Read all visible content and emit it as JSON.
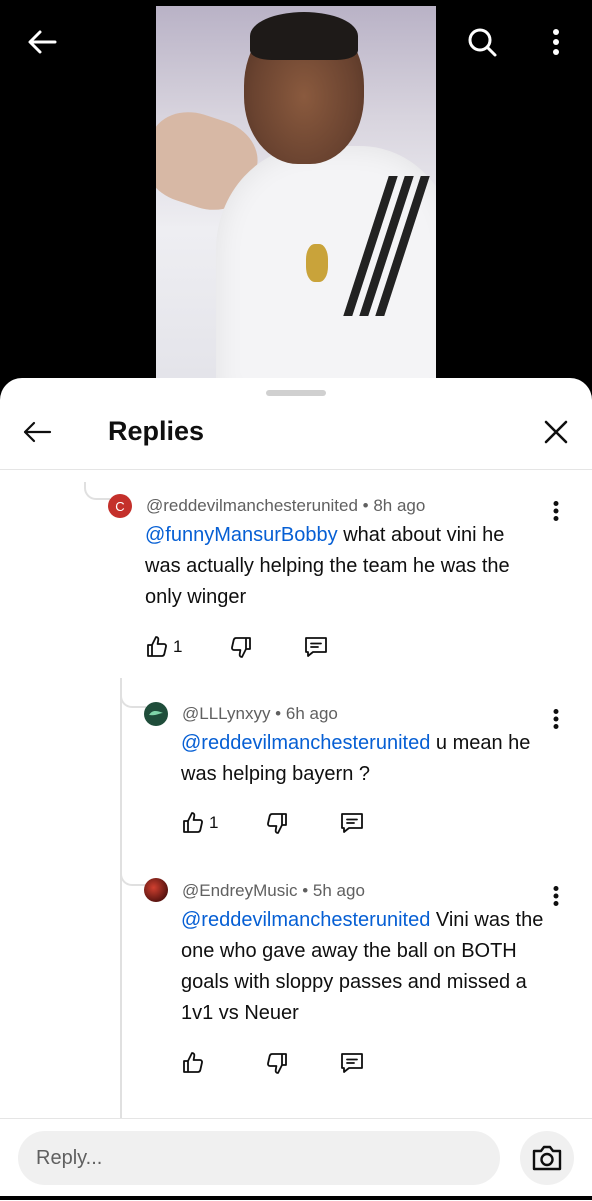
{
  "sheet": {
    "title": "Replies",
    "reply_placeholder": "Reply..."
  },
  "comments": [
    {
      "avatar_letter": "C",
      "avatar_color": "#c4302b",
      "author": "@reddevilmanchesterunited",
      "time": "8h ago",
      "mention": "@funnyMansurBobby",
      "text": " what about vini he was actually helping the team he was the only winger",
      "likes": "1"
    },
    {
      "avatar_color": "#1f4d3a",
      "author": "@LLLynxyy",
      "time": "6h ago",
      "mention": "@reddevilmanchesterunited",
      "text": " u mean he was helping bayern ?",
      "likes": "1"
    },
    {
      "avatar_color": "#5a1410",
      "author": "@EndreyMusic",
      "time": "5h ago",
      "mention": "@reddevilmanchesterunited",
      "text": "  Vini was the one who gave away the ball on BOTH goals with sloppy passes and missed a 1v1 vs Neuer",
      "likes": ""
    }
  ],
  "separator": " • ",
  "icons": {
    "back": "arrow-left-icon",
    "search": "search-icon",
    "more": "more-vert-icon",
    "close": "close-icon",
    "like": "thumb-up-icon",
    "dislike": "thumb-down-icon",
    "reply": "comment-icon",
    "camera": "camera-icon"
  }
}
